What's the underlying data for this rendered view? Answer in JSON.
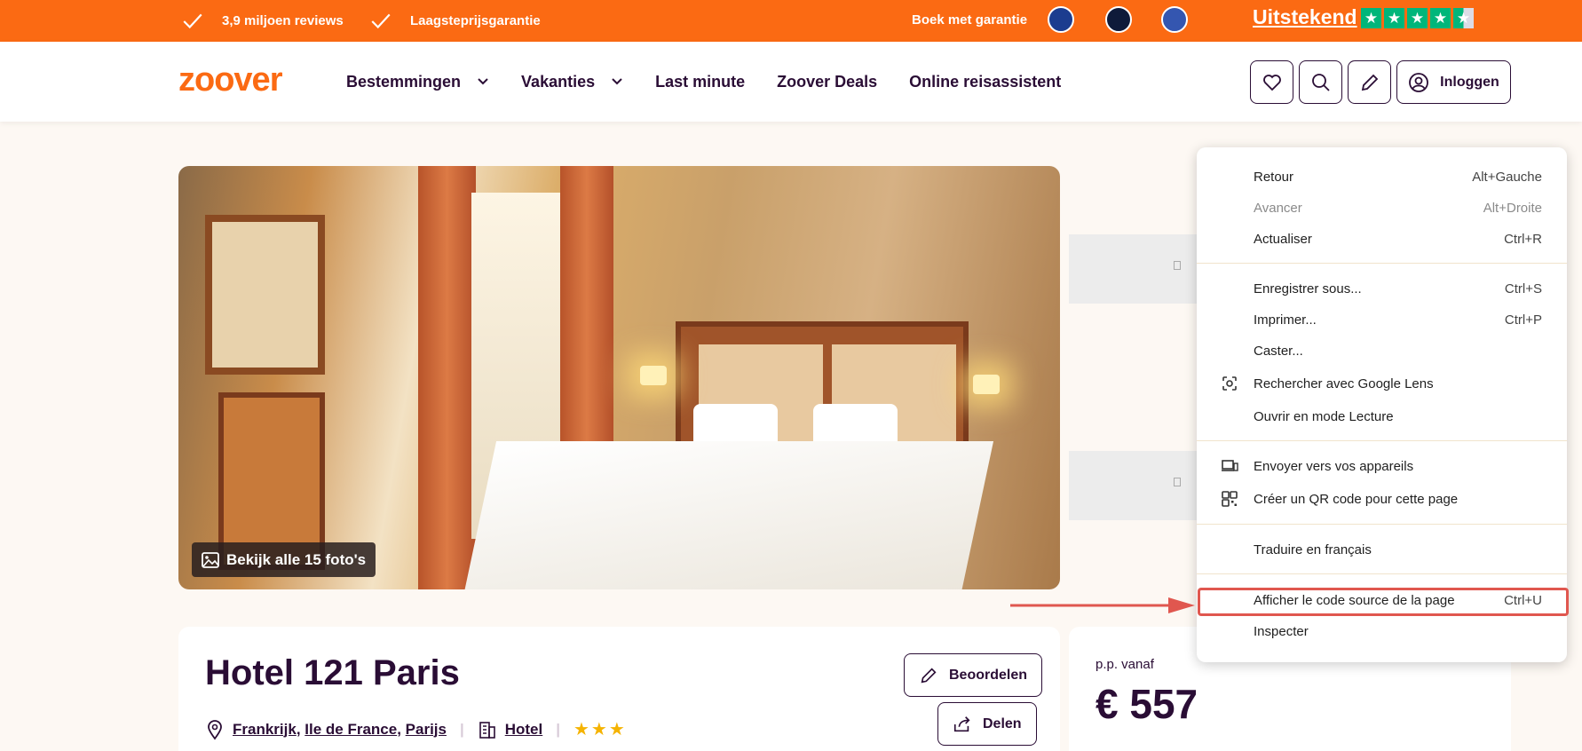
{
  "topbar": {
    "usp1": "3,9 miljoen reviews",
    "usp2": "Laagsteprijsgarantie",
    "guarantee": "Boek met garantie",
    "trust_label": "Uitstekend",
    "trust_rating_stars": 4.5
  },
  "header": {
    "logo": "zoover",
    "nav": [
      {
        "label": "Bestemmingen",
        "has_dropdown": true
      },
      {
        "label": "Vakanties",
        "has_dropdown": true
      },
      {
        "label": "Last minute",
        "has_dropdown": false
      },
      {
        "label": "Zoover Deals",
        "has_dropdown": false
      },
      {
        "label": "Online reisassistent",
        "has_dropdown": false
      }
    ],
    "login_label": "Inloggen",
    "icons": [
      "heart-icon",
      "search-icon",
      "pencil-icon",
      "user-icon"
    ]
  },
  "gallery": {
    "photos_label": "Bekijk alle 15 foto's"
  },
  "hotel": {
    "name": "Hotel 121 Paris",
    "country": "Frankrijk",
    "region": "Ile de France",
    "city": "Parijs",
    "type": "Hotel",
    "stars": 3,
    "review_label": "Beoordelen",
    "share_label": "Delen"
  },
  "price": {
    "from_label": "p.p. vanaf",
    "amount": "€ 557"
  },
  "context_menu": {
    "items": [
      {
        "label": "Retour",
        "shortcut": "Alt+Gauche",
        "disabled": false
      },
      {
        "label": "Avancer",
        "shortcut": "Alt+Droite",
        "disabled": true
      },
      {
        "label": "Actualiser",
        "shortcut": "Ctrl+R",
        "disabled": false
      },
      {
        "label": "Enregistrer sous...",
        "shortcut": "Ctrl+S",
        "disabled": false
      },
      {
        "label": "Imprimer...",
        "shortcut": "Ctrl+P",
        "disabled": false
      },
      {
        "label": "Caster...",
        "shortcut": "",
        "disabled": false
      },
      {
        "label": "Rechercher avec Google Lens",
        "shortcut": "",
        "disabled": false,
        "icon": "google-lens-icon"
      },
      {
        "label": "Ouvrir en mode Lecture",
        "shortcut": "",
        "disabled": false
      },
      {
        "label": "Envoyer vers vos appareils",
        "shortcut": "",
        "disabled": false,
        "icon": "devices-icon"
      },
      {
        "label": "Créer un QR code pour cette page",
        "shortcut": "",
        "disabled": false,
        "icon": "qr-code-icon"
      },
      {
        "label": "Traduire en français",
        "shortcut": "",
        "disabled": false
      },
      {
        "label": "Afficher le code source de la page",
        "shortcut": "Ctrl+U",
        "disabled": false,
        "highlighted": true
      },
      {
        "label": "Inspecter",
        "shortcut": "",
        "disabled": false
      }
    ]
  },
  "colors": {
    "brand_orange": "#fb6a13",
    "brand_purple": "#2a0d35",
    "trustpilot_green": "#00b67a",
    "star_gold": "#f5b301",
    "highlight_red": "#e0574f"
  }
}
